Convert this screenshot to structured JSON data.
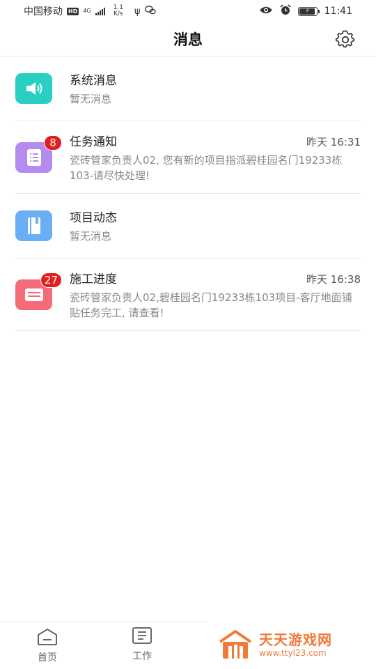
{
  "status_bar": {
    "carrier": "中国移动",
    "hd": "HD",
    "net_type": "4G",
    "speed_value": "1.1",
    "speed_unit": "K/s",
    "time": "11:41"
  },
  "header": {
    "title": "消息",
    "settings_icon": "gear-icon"
  },
  "messages": [
    {
      "title": "系统消息",
      "time": "",
      "subtitle": "暂无消息",
      "badge": "",
      "icon": "speaker-icon",
      "color": "#29d0c2"
    },
    {
      "title": "任务通知",
      "time": "昨天 16:31",
      "subtitle": "瓷砖管家负责人02, 您有新的项目指派碧桂园名门19233栋103-请尽快处理!",
      "badge": "8",
      "icon": "task-list-icon",
      "color": "#b48cf0"
    },
    {
      "title": "项目动态",
      "time": "",
      "subtitle": "暂无消息",
      "badge": "",
      "icon": "notebook-icon",
      "color": "#6aaef5"
    },
    {
      "title": "施工进度",
      "time": "昨天 16:38",
      "subtitle": "瓷砖管家负责人02,碧桂园名门19233栋103项目-客厅地面铺贴任务完工, 请查看!",
      "badge": "27",
      "icon": "progress-card-icon",
      "color": "#f56b78"
    }
  ],
  "tabs": [
    {
      "label": "首页",
      "icon": "home-icon"
    },
    {
      "label": "工作",
      "icon": "work-icon"
    }
  ],
  "watermark": {
    "name": "天天游戏网",
    "url": "www.ttyl23.com",
    "color": "#f07a3a"
  }
}
